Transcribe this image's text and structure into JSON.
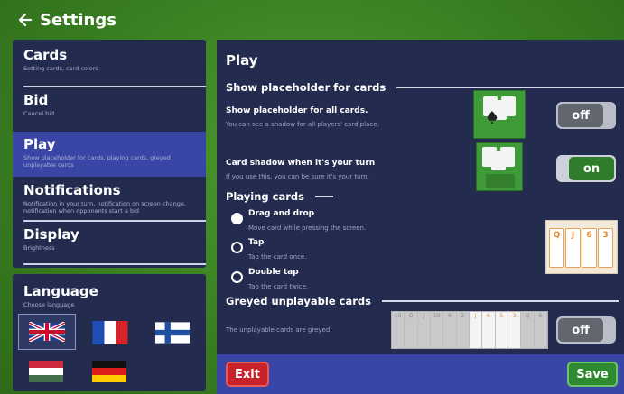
{
  "header": {
    "title": "Settings",
    "back_icon": "arrow-left-icon"
  },
  "sidebar": {
    "items": [
      {
        "label": "Cards",
        "sub": "Setting cards, card colors",
        "active": false
      },
      {
        "label": "Bid",
        "sub": "Cancel bid",
        "active": false
      },
      {
        "label": "Play",
        "sub": "Show placeholder for cards, playing cards, greyed unplayable cards",
        "active": true
      },
      {
        "label": "Notifications",
        "sub": "Notification in your turn, notification on screen change, notification when opponents start a bid",
        "active": false
      },
      {
        "label": "Display",
        "sub": "Brightness",
        "active": false
      }
    ]
  },
  "language": {
    "title": "Language",
    "sub": "Choose language",
    "flags": [
      "uk-flag",
      "france-flag",
      "finland-flag",
      "hungary-flag",
      "germany-flag"
    ],
    "selected": "uk-flag"
  },
  "panel": {
    "title": "Play",
    "placeholder_section": "Show placeholder for cards",
    "placeholder_all_title": "Show placeholder for all cards.",
    "placeholder_all_sub": "You can see a shadow for all players' card place.",
    "placeholder_all_state": "off",
    "shadow_turn_title": "Card shadow when it's your turn",
    "shadow_turn_sub": "If you use this, you can be sure it's your turn.",
    "shadow_turn_state": "on",
    "playing_section": "Playing cards",
    "radio_options": [
      {
        "label": "Drag and drop",
        "sub": "Move card while pressing the screen.",
        "checked": true
      },
      {
        "label": "Tap",
        "sub": "Tap the card once.",
        "checked": false
      },
      {
        "label": "Double tap",
        "sub": "Tap the card twice.",
        "checked": false
      }
    ],
    "greyed_section": "Greyed unplayable cards",
    "greyed_sub": "The unplayable cards are greyed.",
    "greyed_state": "off"
  },
  "footer": {
    "exit_label": "Exit",
    "save_label": "Save"
  },
  "colors": {
    "background": "#3a7f22",
    "panel": "#232c4e",
    "active_item": "#3a46a6",
    "toggle_on": "#2f7d2a",
    "exit": "#c8232b",
    "save": "#2f8b2f"
  }
}
